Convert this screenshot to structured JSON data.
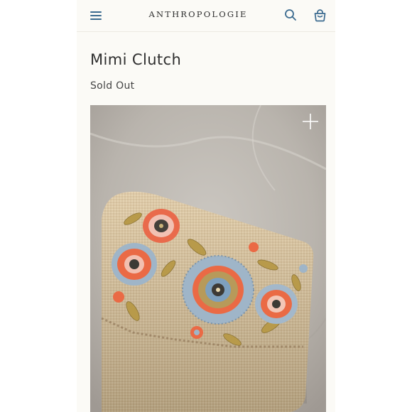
{
  "header": {
    "brand": "ANTHROPOLOGIE",
    "menu_icon": "hamburger-menu-icon",
    "search_icon": "search-icon",
    "bag_icon": "shopping-bag-icon",
    "accent_color": "#3a6a8f"
  },
  "product": {
    "title": "Mimi Clutch",
    "status": "Sold Out",
    "image_icon": "expand-plus-icon"
  },
  "colors": {
    "page_background": "#fbfaf6",
    "text": "#2f2f2f"
  }
}
